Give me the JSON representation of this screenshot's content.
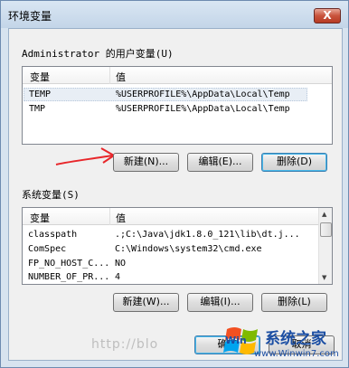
{
  "window": {
    "title": "环境变量",
    "close_glyph": "X"
  },
  "user_vars": {
    "group_label": "Administrator 的用户变量(U)",
    "col_variable": "变量",
    "col_value": "值",
    "rows": [
      {
        "name": "TEMP",
        "value": "%USERPROFILE%\\AppData\\Local\\Temp"
      },
      {
        "name": "TMP",
        "value": "%USERPROFILE%\\AppData\\Local\\Temp"
      }
    ],
    "new_button": "新建(N)...",
    "edit_button": "编辑(E)...",
    "delete_button": "删除(D)"
  },
  "system_vars": {
    "group_label": "系统变量(S)",
    "col_variable": "变量",
    "col_value": "值",
    "rows": [
      {
        "name": "classpath",
        "value": ".;C:\\Java\\jdk1.8.0_121\\lib\\dt.j..."
      },
      {
        "name": "ComSpec",
        "value": "C:\\Windows\\system32\\cmd.exe"
      },
      {
        "name": "FP_NO_HOST_C...",
        "value": "NO"
      },
      {
        "name": "NUMBER_OF_PR...",
        "value": "4"
      }
    ],
    "new_button": "新建(W)...",
    "edit_button": "编辑(I)...",
    "delete_button": "删除(L)"
  },
  "footer": {
    "ok_button": "确定",
    "cancel_button": "取消"
  },
  "overlay": {
    "watermark_text": "http://blo",
    "logo_text": "系统之家",
    "logo_url": "www.Winwin7.com",
    "logo_brand": "Win"
  },
  "colors": {
    "annotation_arrow": "#e8262a",
    "logo_blue": "#1b4ea3",
    "close_red": "#c9533c"
  },
  "icons": {
    "close": "close-icon",
    "scroll_up": "scroll-up-arrow-icon",
    "scroll_down": "scroll-down-arrow-icon"
  }
}
